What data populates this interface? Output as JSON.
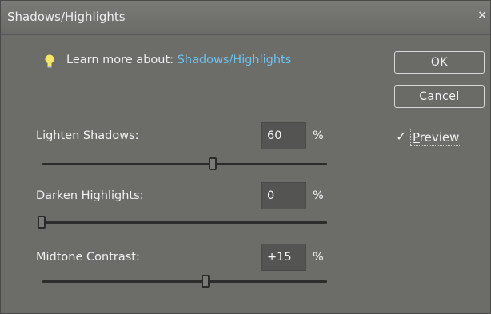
{
  "window": {
    "title": "Shadows/Highlights",
    "close_glyph": "×"
  },
  "learn": {
    "prefix": "Learn more about:",
    "link": "Shadows/Highlights",
    "icon": "lightbulb-icon"
  },
  "buttons": {
    "ok": "OK",
    "cancel": "Cancel"
  },
  "preview": {
    "checked": true,
    "check_glyph": "✓",
    "label_first": "P",
    "label_rest": "review"
  },
  "sliders": [
    {
      "label": "Lighten Shadows:",
      "value": "60",
      "unit": "%",
      "level": 0.6
    },
    {
      "label": "Darken Highlights:",
      "value": "0",
      "unit": "%",
      "level": 0.0
    },
    {
      "label": "Midtone Contrast:",
      "value": "+15",
      "unit": "%",
      "level": 0.575
    }
  ],
  "colors": {
    "panel": "#6c6c69",
    "link": "#6fc3f0",
    "bulb": "#f5e66a"
  }
}
